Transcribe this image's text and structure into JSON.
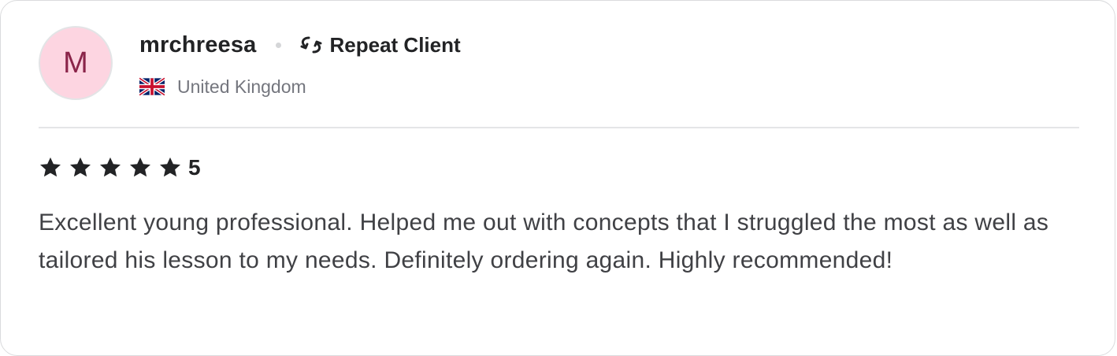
{
  "reviewer": {
    "avatar_letter": "M",
    "avatar_bg": "#fdd5e1",
    "avatar_fg": "#8a2449",
    "username": "mrchreesa",
    "badge_icon": "repeat-icon",
    "badge_label": "Repeat Client",
    "country_flag_icon": "uk-flag-icon",
    "country": "United Kingdom"
  },
  "rating": {
    "stars": 5,
    "max_stars": 5,
    "value": "5",
    "star_color": "#222325"
  },
  "review": {
    "text": "Excellent young professional. Helped me out with concepts that I struggled the most as well as tailored his lesson to my needs. Definitely ordering again. Highly recommended!"
  }
}
